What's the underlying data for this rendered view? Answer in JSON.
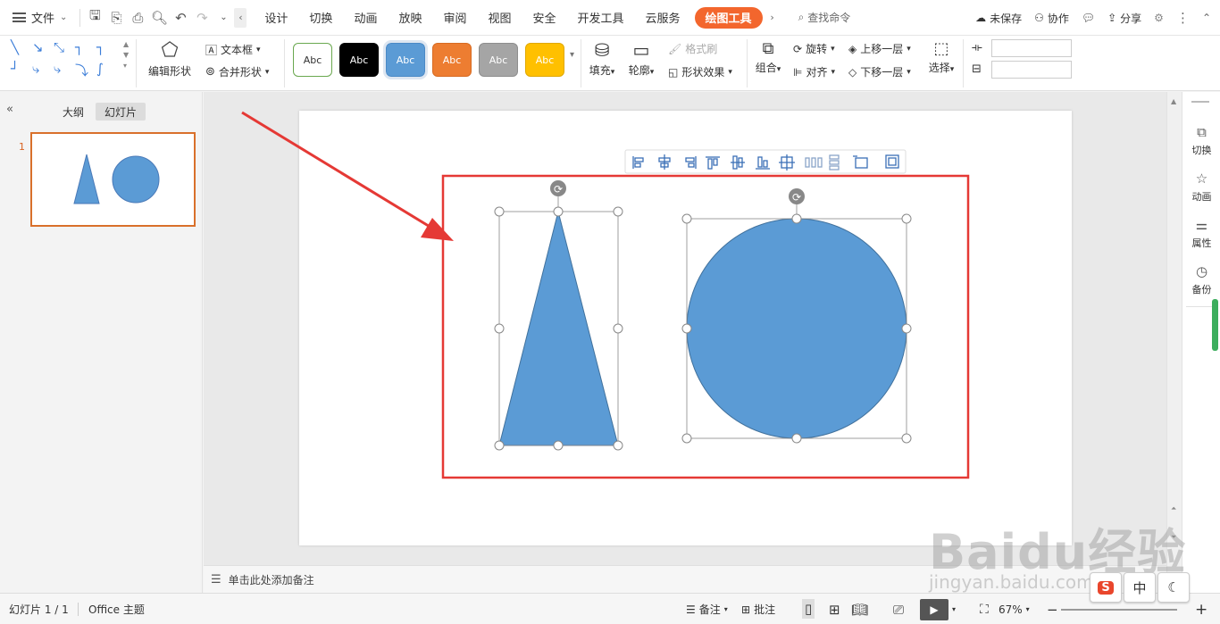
{
  "menubar": {
    "file_label": "文件",
    "tabs": [
      {
        "label": "设计"
      },
      {
        "label": "切换"
      },
      {
        "label": "动画"
      },
      {
        "label": "放映"
      },
      {
        "label": "审阅"
      },
      {
        "label": "视图"
      },
      {
        "label": "安全"
      },
      {
        "label": "开发工具"
      },
      {
        "label": "云服务"
      },
      {
        "label": "绘图工具"
      }
    ],
    "active_tab": "绘图工具",
    "search_placeholder": "查找命令",
    "unsaved_label": "未保存",
    "collab_label": "协作",
    "share_label": "分享"
  },
  "ribbon": {
    "edit_shape_label": "编辑形状",
    "textbox_label": "文本框",
    "merge_shape_label": "合并形状",
    "styles": [
      {
        "label": "Abc",
        "bg": "#ffffff",
        "fg": "#333333",
        "border": "#6aa84f"
      },
      {
        "label": "Abc",
        "bg": "#000000",
        "fg": "#ffffff",
        "border": "#000000"
      },
      {
        "label": "Abc",
        "bg": "#5b9bd5",
        "fg": "#ffffff",
        "border": "#4a89c6"
      },
      {
        "label": "Abc",
        "bg": "#ed7d31",
        "fg": "#ffffff",
        "border": "#d76b22"
      },
      {
        "label": "Abc",
        "bg": "#a5a5a5",
        "fg": "#ffffff",
        "border": "#8e8e8e"
      },
      {
        "label": "Abc",
        "bg": "#ffc000",
        "fg": "#ffffff",
        "border": "#e0a800"
      }
    ],
    "fill_label": "填充",
    "outline_label": "轮廓",
    "format_brush_label": "格式刷",
    "shape_effect_label": "形状效果",
    "group_label": "组合",
    "rotate_label": "旋转",
    "align_label": "对齐",
    "bring_forward_label": "上移一层",
    "send_backward_label": "下移一层",
    "select_label": "选择"
  },
  "leftpanel": {
    "outline_tab": "大纲",
    "slides_tab": "幻灯片",
    "slide_number": "1"
  },
  "notes": {
    "placeholder": "单击此处添加备注"
  },
  "rightpanel": {
    "items": [
      {
        "label": "切换"
      },
      {
        "label": "动画"
      },
      {
        "label": "属性"
      },
      {
        "label": "备份"
      }
    ]
  },
  "statusbar": {
    "slide_info": "幻灯片 1 / 1",
    "theme": "Office 主题",
    "notes_label": "备注",
    "comment_label": "批注",
    "zoom": "67%"
  },
  "tray": {
    "ime_label": "中"
  },
  "watermark": {
    "main": "Baidu经验",
    "url": "jingyan.baidu.com"
  },
  "colors": {
    "accent": "#f3662d",
    "shape_fill": "#5b9bd5",
    "highlight_box": "#e53935",
    "arrow": "#e53935"
  }
}
